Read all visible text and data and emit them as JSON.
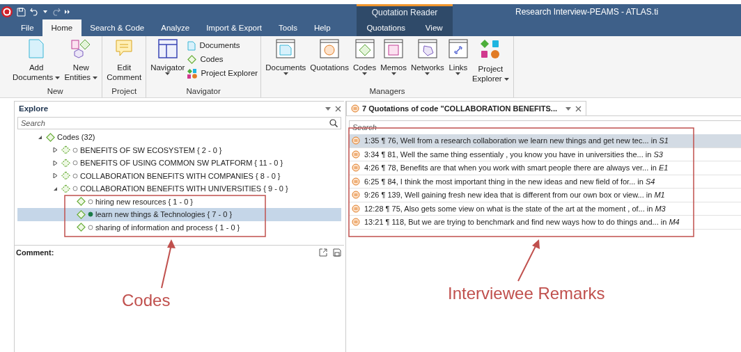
{
  "title_bar": {
    "title": "Research Interview-PEAMS - ATLAS.ti",
    "context_group": "Quotation Reader"
  },
  "menu_tabs": [
    {
      "label": "File",
      "selected": false
    },
    {
      "label": "Home",
      "selected": true
    },
    {
      "label": "Search & Code",
      "selected": false
    },
    {
      "label": "Analyze",
      "selected": false
    },
    {
      "label": "Import & Export",
      "selected": false
    },
    {
      "label": "Tools",
      "selected": false
    },
    {
      "label": "Help",
      "selected": false
    }
  ],
  "context_tabs": [
    {
      "label": "Quotations",
      "selected": false
    },
    {
      "label": "View",
      "selected": false
    }
  ],
  "ribbon": [
    {
      "label": "New",
      "items": [
        {
          "kind": "large",
          "lines": [
            "Add",
            "Documents"
          ],
          "dropdown": true
        },
        {
          "kind": "large",
          "lines": [
            "New",
            "Entities"
          ],
          "dropdown": true
        }
      ]
    },
    {
      "label": "Project",
      "items": [
        {
          "kind": "large",
          "lines": [
            "Edit",
            "Comment"
          ],
          "dropdown": false
        }
      ]
    },
    {
      "label": "Navigator",
      "items": [
        {
          "kind": "large",
          "lines": [
            "Navigator"
          ],
          "dropdown": true
        },
        {
          "kind": "small",
          "lines": [
            "Documents"
          ]
        },
        {
          "kind": "small",
          "lines": [
            "Codes"
          ]
        },
        {
          "kind": "small",
          "lines": [
            "Project Explorer"
          ]
        }
      ]
    },
    {
      "label": "Managers",
      "items": [
        {
          "kind": "large",
          "lines": [
            "Documents"
          ],
          "dropdown": true
        },
        {
          "kind": "large",
          "lines": [
            "Quotations"
          ],
          "dropdown": false
        },
        {
          "kind": "large",
          "lines": [
            "Codes"
          ],
          "dropdown": true
        },
        {
          "kind": "large",
          "lines": [
            "Memos"
          ],
          "dropdown": true
        },
        {
          "kind": "large",
          "lines": [
            "Networks"
          ],
          "dropdown": true
        },
        {
          "kind": "large",
          "lines": [
            "Links"
          ],
          "dropdown": true
        },
        {
          "kind": "large",
          "lines": [
            "Project",
            "Explorer"
          ],
          "dropdown": true
        }
      ]
    }
  ],
  "explore": {
    "title": "Explore",
    "search": {
      "placeholder": "Search"
    },
    "tree": [
      {
        "label": "Codes (32)",
        "expanded": true,
        "selected": false,
        "children": [
          {
            "label": "BENEFITS OF SW ECOSYSTEM",
            "count": "{ 2 - 0 }",
            "expanded": false,
            "marked": false,
            "selected": false
          },
          {
            "label": "BENEFITS OF USING COMMON SW PLATFORM",
            "count": "{ 11 - 0 }",
            "expanded": false,
            "marked": false,
            "selected": false
          },
          {
            "label": "COLLABORATION BENEFITS WITH COMPANIES",
            "count": "{ 8 - 0 }",
            "expanded": false,
            "marked": false,
            "selected": false
          },
          {
            "label": "COLLABORATION BENEFITS WITH UNIVERSITIES",
            "count": "{ 9 - 0 }",
            "expanded": true,
            "marked": false,
            "selected": false,
            "children": [
              {
                "label": "hiring new resources",
                "count": "{ 1 - 0 }",
                "marked": false,
                "selected": false
              },
              {
                "label": "learn new things & Technologies",
                "count": "{ 7 - 0 }",
                "marked": true,
                "selected": true
              },
              {
                "label": "sharing of information and process",
                "count": "{ 1 - 0 }",
                "marked": false,
                "selected": false
              }
            ]
          }
        ]
      }
    ],
    "comment_label": "Comment:"
  },
  "quotations": {
    "tab_title": "7 Quotations of code \"COLLABORATION BENEFITS...",
    "search": {
      "placeholder": "Search"
    },
    "rows": [
      {
        "text": "1:35 ¶ 76, Well from a research collaboration we learn new things and get new tec... in *S1*",
        "selected": true
      },
      {
        "text": "3:34 ¶ 81, Well the same thing essentialy , you know you have in universities the... in *S3*",
        "selected": false
      },
      {
        "text": "4:26 ¶ 78, Benefits are that when you work with smart people there are always ver... in *E1*",
        "selected": false
      },
      {
        "text": "6:25 ¶ 84, I think the most important thing in the new ideas and new field of for... in *S4*",
        "selected": false
      },
      {
        "text": "9:26 ¶ 139, Well gaining fresh new idea that is different from our own box or view... in *M1*",
        "selected": false
      },
      {
        "text": "12:28 ¶ 75, Also gets some view on what is the state of the art at the moment , of... in *M3*",
        "selected": false
      },
      {
        "text": "13:21 ¶ 118, But we are trying to benchmark and find new ways how to do things and... in *M4*",
        "selected": false
      }
    ]
  },
  "annotations": [
    {
      "label": "Codes"
    },
    {
      "label": "Interviewee Remarks"
    }
  ]
}
